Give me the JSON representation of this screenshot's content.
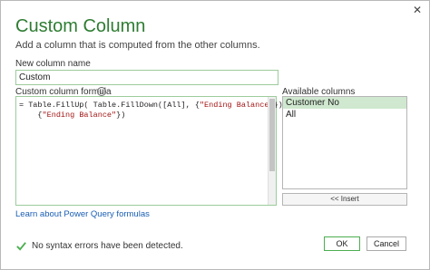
{
  "dialog": {
    "close_glyph": "✕",
    "title": "Custom Column",
    "subtitle": "Add a column that is computed from the other columns."
  },
  "name_field": {
    "label": "New column name",
    "value": "Custom"
  },
  "formula": {
    "label": "Custom column formula",
    "info_glyph": "i",
    "line1_part1": "= Table.FillUp( Table.FillDown([All], {",
    "line1_string": "\"Ending Balance\"",
    "line1_part2": "}),",
    "line2_prefix": "    {",
    "line2_string": "\"Ending Balance\"",
    "line2_suffix": "})"
  },
  "available_columns": {
    "label": "Available columns",
    "items": [
      "Customer No",
      "All"
    ],
    "selected": "Customer No",
    "insert_label": "<< Insert"
  },
  "learn_link": "Learn about Power Query formulas",
  "status": {
    "text": "No syntax errors have been detected.",
    "icon": "check-icon",
    "color": "#4caf50"
  },
  "buttons": {
    "ok": "OK",
    "cancel": "Cancel"
  },
  "colors": {
    "title": "#2e7d32",
    "accent_border": "#9ccc9c",
    "selection": "#cfe8cf",
    "link": "#1a5fb4",
    "string_literal": "#a31515"
  }
}
